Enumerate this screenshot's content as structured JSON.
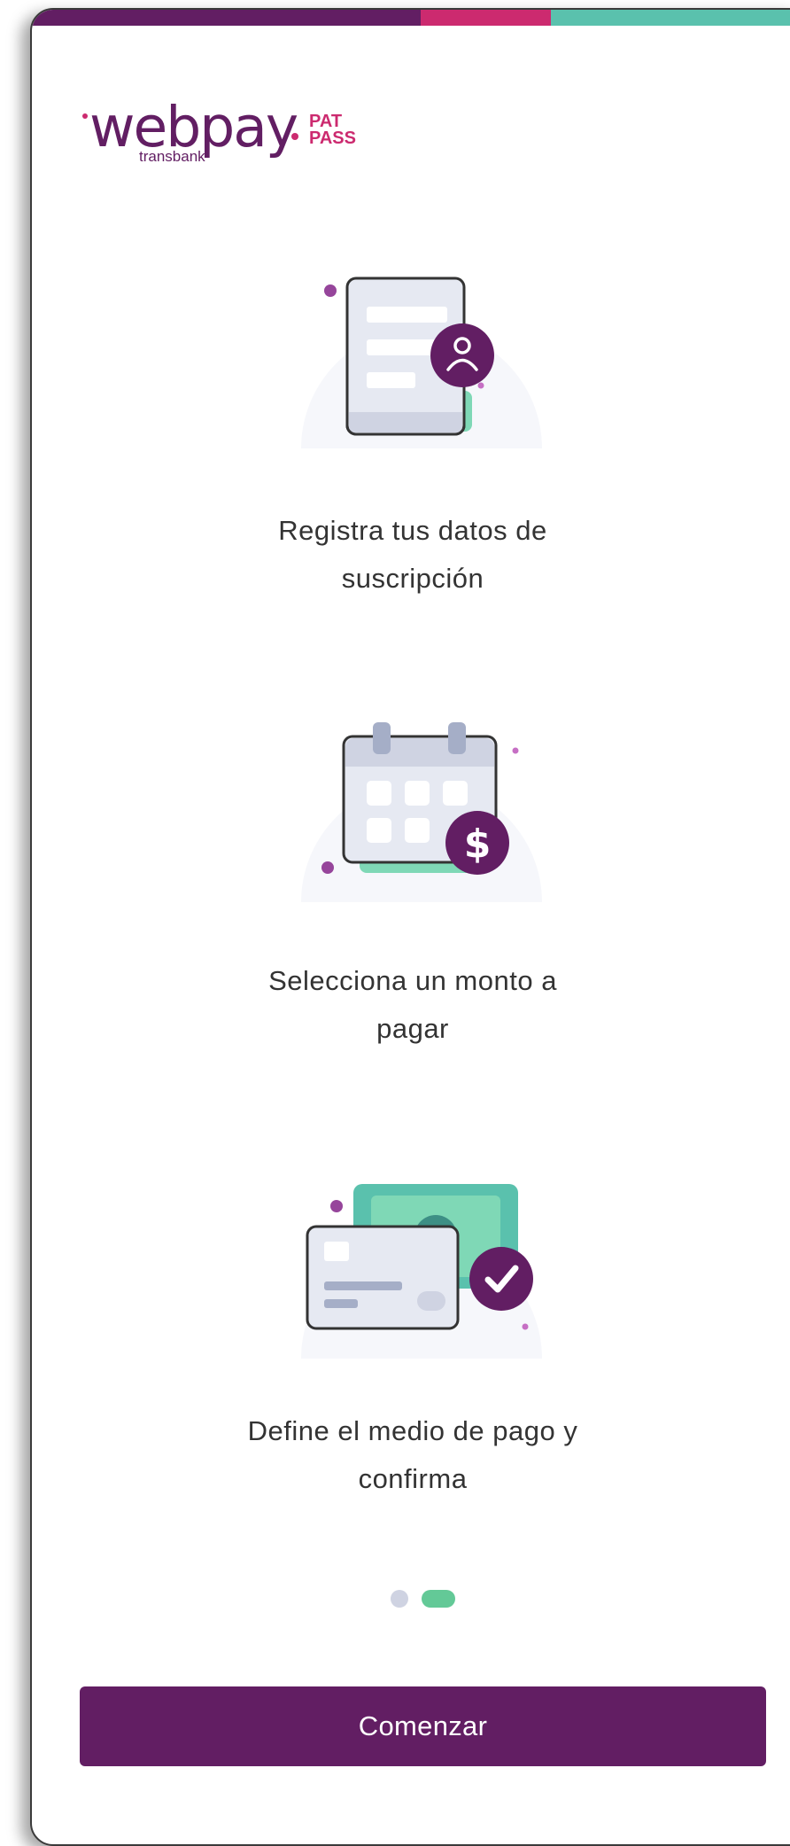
{
  "colors": {
    "brand_purple": "#621e63",
    "accent_pink": "#cc2a6f",
    "accent_teal": "#5ac1ad",
    "pager_active": "#63c997",
    "pager_inactive": "#cfd3e2",
    "text": "#333333"
  },
  "brand": {
    "name": "webpay",
    "sub": "transbank",
    "badge_line1": "PAT",
    "badge_line2": "PASS"
  },
  "steps": [
    {
      "icon": "document-user-icon",
      "line1": "Registra tus datos de",
      "line2": "suscripción"
    },
    {
      "icon": "calendar-dollar-icon",
      "line1": "Selecciona un monto a",
      "line2": "pagar"
    },
    {
      "icon": "card-cash-check-icon",
      "line1": "Define el medio de pago y",
      "line2": "confirma"
    }
  ],
  "pager": {
    "pages": 2,
    "current": 2
  },
  "cta": {
    "label": "Comenzar"
  }
}
